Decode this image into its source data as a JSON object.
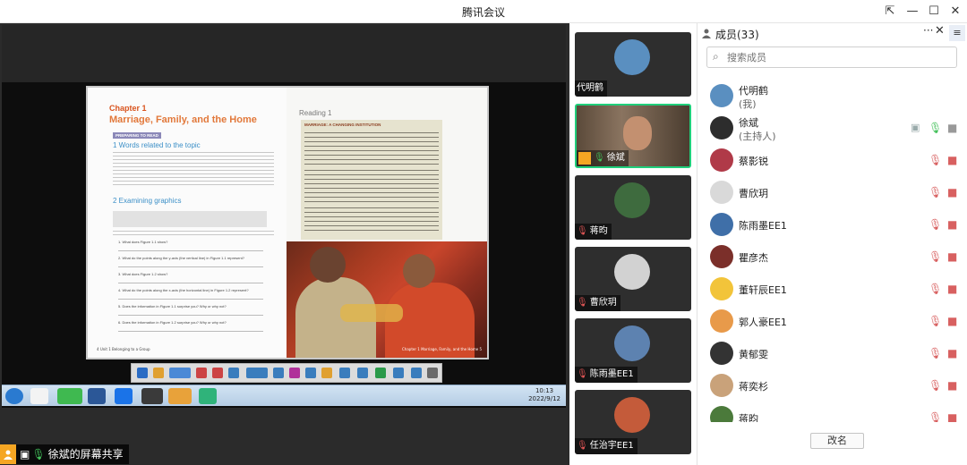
{
  "window": {
    "title": "腾讯会议",
    "minimize": "—",
    "maximize": "☐",
    "close": "✕",
    "pin": "⇱"
  },
  "share": {
    "label": "徐斌的屏幕共享"
  },
  "book": {
    "chapter": "Chapter 1",
    "chapter_title": "Marriage, Family, and the Home",
    "prepare_tag": "PREPARING TO READ",
    "section1": "1 Words related to the topic",
    "section2": "2 Examining graphics",
    "reading": "Reading 1",
    "article_head": "MARRIAGE: A CHANGING INSTITUTION",
    "footer_left": "4 Unit 1 Belonging to a Group",
    "footer_right": "Chapter 1 Marriage, Family, and the Home 5",
    "questions": [
      "1. What does Figure 1.1 show?",
      "2. What do the points along the y-axis (the vertical line) in Figure 1.1 represent?",
      "3. What does Figure 1.2 show?",
      "4. What do the points along the x-axis (the horizontal line) in Figure 1.2 represent?",
      "5. Does the information in Figure 1.1 surprise you? Why or why not?",
      "6. Does the information in Figure 1.2 surprise you? Why or why not?"
    ]
  },
  "taskbar": {
    "time": "10:13",
    "date": "2022/9/12"
  },
  "tiles": [
    {
      "name": "代明鹤",
      "mic": "none",
      "avatar": "#5a8fc0"
    },
    {
      "name": "徐斌",
      "mic": "on",
      "avatar": "#6a5a48"
    },
    {
      "name": "蒋昀",
      "mic": "off",
      "avatar": "#3e6b3e"
    },
    {
      "name": "曹欣玥",
      "mic": "off",
      "avatar": "#c8c8c8"
    },
    {
      "name": "陈雨墨EE1",
      "mic": "off",
      "avatar": "#5d82b0"
    },
    {
      "name": "任治宇EE1",
      "mic": "off",
      "avatar": "#c45b3a"
    }
  ],
  "panel": {
    "title": "成员(33)",
    "more": "···",
    "close": "✕",
    "menu": "≡",
    "search_placeholder": "搜索成员",
    "rename": "改名",
    "members": [
      {
        "name": "代明鹤",
        "sub": "(我)",
        "avatar": "#5a8fc0",
        "mic": "none"
      },
      {
        "name": "徐斌",
        "sub": "(主持人)",
        "avatar": "#2d2d2d",
        "mic": "on"
      },
      {
        "name": "蔡影锐",
        "sub": "",
        "avatar": "#b03a48",
        "mic": "off"
      },
      {
        "name": "曹欣玥",
        "sub": "",
        "avatar": "#d9d9d9",
        "mic": "off"
      },
      {
        "name": "陈雨墨EE1",
        "sub": "",
        "avatar": "#3f6fa8",
        "mic": "off"
      },
      {
        "name": "瞿彦杰",
        "sub": "",
        "avatar": "#7b2f2a",
        "mic": "off"
      },
      {
        "name": "董轩辰EE1",
        "sub": "",
        "avatar": "#f2c43a",
        "mic": "off"
      },
      {
        "name": "郭人豪EE1",
        "sub": "",
        "avatar": "#e89a4a",
        "mic": "off"
      },
      {
        "name": "黄郁雯",
        "sub": "",
        "avatar": "#333333",
        "mic": "off"
      },
      {
        "name": "蒋奕杉",
        "sub": "",
        "avatar": "#c9a27a",
        "mic": "off"
      },
      {
        "name": "蒋昀",
        "sub": "",
        "avatar": "#4b7a3b",
        "mic": "off"
      }
    ]
  },
  "colors": {
    "accent_green": "#1fcf7b",
    "mic_off_red": "#d86060",
    "share_orange": "#f5a623"
  }
}
